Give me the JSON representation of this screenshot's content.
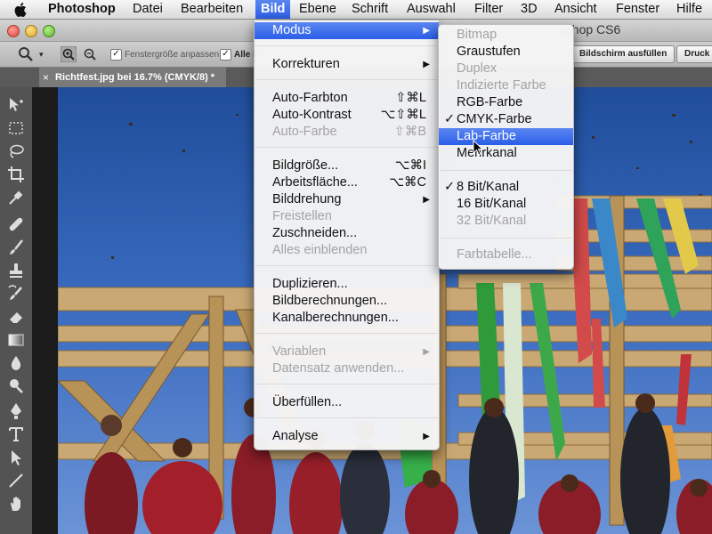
{
  "menubar": {
    "app": "Photoshop",
    "items": [
      "Datei",
      "Bearbeiten",
      "Bild",
      "Ebene",
      "Schrift",
      "Auswahl",
      "Filter",
      "3D",
      "Ansicht",
      "Fenster",
      "Hilfe"
    ]
  },
  "window": {
    "title_fragment": "oshop CS6"
  },
  "options": {
    "fit_label": "Fenstergröße anpassen",
    "all_label": "Alle F",
    "fill_button": "Bildschirm ausfüllen",
    "print_button": "Druck"
  },
  "document": {
    "tab_title": "Richtfest.jpg bei 16.7% (CMYK/8) *"
  },
  "bild_menu": {
    "items": [
      {
        "label": "Modus",
        "arrow": "▶",
        "highlighted": true
      },
      {
        "label": "Korrekturen",
        "arrow": "▶"
      },
      {
        "label": "Auto-Farbton",
        "shortcut": "⇧⌘L"
      },
      {
        "label": "Auto-Kontrast",
        "shortcut": "⌥⇧⌘L"
      },
      {
        "label": "Auto-Farbe",
        "shortcut": "⇧⌘B",
        "disabled": true
      },
      {
        "label": "Bildgröße...",
        "shortcut": "⌥⌘I"
      },
      {
        "label": "Arbeitsfläche...",
        "shortcut": "⌥⌘C"
      },
      {
        "label": "Bilddrehung",
        "arrow": "▶"
      },
      {
        "label": "Freistellen",
        "disabled": true
      },
      {
        "label": "Zuschneiden..."
      },
      {
        "label": "Alles einblenden",
        "disabled": true
      },
      {
        "label": "Duplizieren..."
      },
      {
        "label": "Bildberechnungen..."
      },
      {
        "label": "Kanalberechnungen..."
      },
      {
        "label": "Variablen",
        "arrow": "▶",
        "disabled": true
      },
      {
        "label": "Datensatz anwenden...",
        "disabled": true
      },
      {
        "label": "Überfüllen..."
      },
      {
        "label": "Analyse",
        "arrow": "▶"
      }
    ]
  },
  "modus_menu": {
    "items": [
      {
        "label": "Bitmap",
        "disabled": true
      },
      {
        "label": "Graustufen"
      },
      {
        "label": "Duplex",
        "disabled": true
      },
      {
        "label": "Indizierte Farbe",
        "disabled": true
      },
      {
        "label": "RGB-Farbe"
      },
      {
        "label": "CMYK-Farbe",
        "checked": "✓"
      },
      {
        "label": "Lab-Farbe",
        "highlighted": true
      },
      {
        "label": "Mehrkanal"
      },
      {
        "label": "8 Bit/Kanal",
        "checked": "✓"
      },
      {
        "label": "16 Bit/Kanal"
      },
      {
        "label": "32 Bit/Kanal",
        "disabled": true
      },
      {
        "label": "Farbtabelle...",
        "disabled": true
      }
    ]
  },
  "colors": {
    "highlight": "#2b5ee8",
    "menu_bg": "#f5f5f5",
    "disabled": "#a3a3a3"
  }
}
